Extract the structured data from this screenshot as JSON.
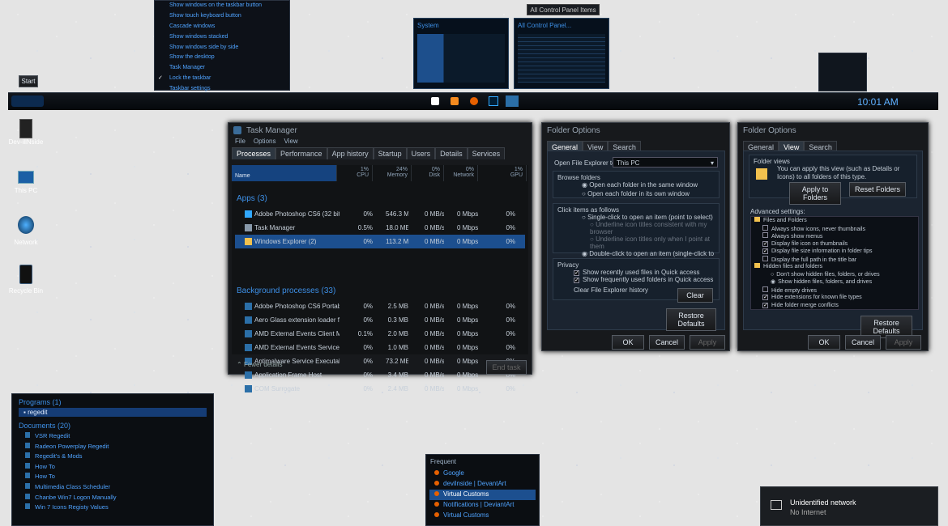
{
  "top": {
    "context_menu": [
      "Show windows on the taskbar button",
      "Show touch keyboard button",
      "Cascade windows",
      "Show windows stacked",
      "Show windows side by side",
      "Show the desktop",
      "Task Manager",
      "Lock the taskbar",
      "Taskbar settings"
    ],
    "start_label": "Start",
    "tooltip": "All Control Panel Items",
    "thumb1": "System",
    "thumb2": "All Control Panel...",
    "clock": "10:01 AM"
  },
  "desktop": {
    "icons": [
      "Dev-illNside",
      "This PC",
      "Network",
      "Recycle Bin"
    ]
  },
  "taskmgr": {
    "title": "Task Manager",
    "menu": [
      "File",
      "Options",
      "View"
    ],
    "tabs": [
      "Processes",
      "Performance",
      "App history",
      "Startup",
      "Users",
      "Details",
      "Services"
    ],
    "columns": [
      {
        "pct": "",
        "name": "Name"
      },
      {
        "pct": "1%",
        "name": "CPU"
      },
      {
        "pct": "24%",
        "name": "Memory"
      },
      {
        "pct": "0%",
        "name": "Disk"
      },
      {
        "pct": "0%",
        "name": "Network"
      },
      {
        "pct": "1%",
        "name": "GPU"
      }
    ],
    "apps_header": "Apps (3)",
    "apps": [
      {
        "name": "Adobe Photoshop CS6 (32 bit)",
        "cpu": "0%",
        "mem": "546.3 MB",
        "disk": "0 MB/s",
        "net": "0 Mbps",
        "gpu": "0%"
      },
      {
        "name": "Task Manager",
        "cpu": "0.5%",
        "mem": "18.0 MB",
        "disk": "0 MB/s",
        "net": "0 Mbps",
        "gpu": "0%"
      },
      {
        "name": "Windows Explorer (2)",
        "cpu": "0%",
        "mem": "113.2 MB",
        "disk": "0 MB/s",
        "net": "0 Mbps",
        "gpu": "0%"
      }
    ],
    "bg_header": "Background processes (33)",
    "bg": [
      {
        "name": "Adobe Photoshop CS6 Portable ...",
        "cpu": "0%",
        "mem": "2.5 MB",
        "disk": "0 MB/s",
        "net": "0 Mbps",
        "gpu": "0%"
      },
      {
        "name": "Aero Glass extension loader fo...",
        "cpu": "0%",
        "mem": "0.3 MB",
        "disk": "0 MB/s",
        "net": "0 Mbps",
        "gpu": "0%"
      },
      {
        "name": "AMD External Events Client Mod...",
        "cpu": "0.1%",
        "mem": "2.0 MB",
        "disk": "0 MB/s",
        "net": "0 Mbps",
        "gpu": "0%"
      },
      {
        "name": "AMD External Events Service M...",
        "cpu": "0%",
        "mem": "1.0 MB",
        "disk": "0 MB/s",
        "net": "0 Mbps",
        "gpu": "0%"
      },
      {
        "name": "Antimalware Service Executable",
        "cpu": "0%",
        "mem": "73.2 MB",
        "disk": "0 MB/s",
        "net": "0 Mbps",
        "gpu": "0%"
      },
      {
        "name": "Application Frame Host",
        "cpu": "0%",
        "mem": "3.4 MB",
        "disk": "0 MB/s",
        "net": "0 Mbps",
        "gpu": "0%"
      },
      {
        "name": "COM Surrogate",
        "cpu": "0%",
        "mem": "2.4 MB",
        "disk": "0 MB/s",
        "net": "0 Mbps",
        "gpu": "0%"
      }
    ],
    "fewer": "Fewer details",
    "end_task": "End task"
  },
  "fo1": {
    "title": "Folder Options",
    "tabs": [
      "General",
      "View",
      "Search"
    ],
    "open_label": "Open File Explorer to:",
    "open_value": "This PC",
    "browse_title": "Browse folders",
    "browse_opts": [
      "Open each folder in the same window",
      "Open each folder in its own window"
    ],
    "click_title": "Click items as follows",
    "click_opts": [
      "Single-click to open an item (point to select)",
      "Underline icon titles consistent with my browser",
      "Underline icon titles only when I point at them",
      "Double-click to open an item (single-click to select)"
    ],
    "privacy_title": "Privacy",
    "privacy_opts": [
      "Show recently used files in Quick access",
      "Show frequently used folders in Quick access"
    ],
    "clear_label": "Clear File Explorer history",
    "clear_btn": "Clear",
    "restore": "Restore Defaults",
    "ok": "OK",
    "cancel": "Cancel",
    "apply": "Apply"
  },
  "fo2": {
    "title": "Folder Options",
    "tabs": [
      "General",
      "View",
      "Search"
    ],
    "views_title": "Folder views",
    "views_text": "You can apply this view (such as Details or Icons) to all folders of this type.",
    "apply_folders": "Apply to Folders",
    "reset_folders": "Reset Folders",
    "adv_title": "Advanced settings:",
    "adv": [
      {
        "t": "Files and Folders",
        "k": "folder"
      },
      {
        "t": "Always show icons, never thumbnails",
        "k": "off"
      },
      {
        "t": "Always show menus",
        "k": "off"
      },
      {
        "t": "Display file icon on thumbnails",
        "k": "on"
      },
      {
        "t": "Display file size information in folder tips",
        "k": "on"
      },
      {
        "t": "Display the full path in the title bar",
        "k": "off"
      },
      {
        "t": "Hidden files and folders",
        "k": "folder"
      },
      {
        "t": "Don't show hidden files, folders, or drives",
        "k": "rad-off"
      },
      {
        "t": "Show hidden files, folders, and drives",
        "k": "rad-on"
      },
      {
        "t": "Hide empty drives",
        "k": "off"
      },
      {
        "t": "Hide extensions for known file types",
        "k": "on"
      },
      {
        "t": "Hide folder merge conflicts",
        "k": "on"
      }
    ],
    "restore": "Restore Defaults",
    "ok": "OK",
    "cancel": "Cancel",
    "apply": "Apply"
  },
  "search": {
    "programs_title": "Programs (1)",
    "programs": [
      "regedit"
    ],
    "docs_title": "Documents (20)",
    "docs": [
      "VSR Regedit",
      "Radeon Powerplay Regedit",
      "Regedit's & Mods",
      "How To",
      "How To",
      "Multimedia Class Scheduler",
      "Chanbe Win7 Logon Manually",
      "Win 7 Icons Registy Values"
    ]
  },
  "jumplist": {
    "title": "Frequent",
    "items": [
      "Google",
      "devilnside | DevantArt",
      "Virtual Customs",
      "Notifications | DeviantArt",
      "Virtual Customs"
    ]
  },
  "network": {
    "title": "Unidentified network",
    "status": "No Internet"
  }
}
